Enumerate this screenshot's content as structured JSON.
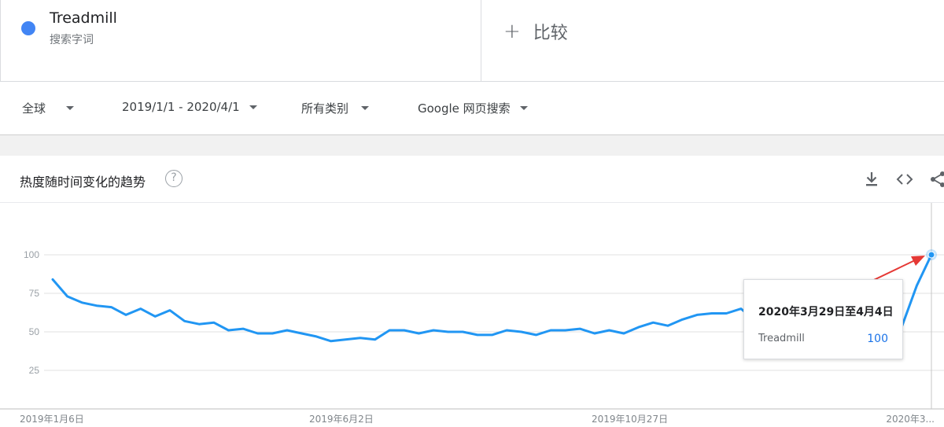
{
  "term": {
    "name": "Treadmill",
    "subtitle": "搜索字词",
    "dot_color": "#4285f4"
  },
  "compare": {
    "plus": "+",
    "label": "比较"
  },
  "filters": {
    "region": "全球",
    "date_range": "2019/1/1 - 2020/4/1",
    "category": "所有类别",
    "search_type": "Google 网页搜索"
  },
  "card": {
    "title": "热度随时间变化的趋势",
    "help_glyph": "?",
    "icons": [
      "download-icon",
      "embed-code-icon",
      "share-icon"
    ]
  },
  "tooltip": {
    "date": "2020年3月29日至4月4日",
    "term": "Treadmill",
    "value": "100"
  },
  "chart_data": {
    "type": "line",
    "ylim": [
      0,
      100
    ],
    "yticks": [
      25,
      50,
      75,
      100
    ],
    "x_tick_labels": [
      "2019年1月6日",
      "2019年6月2日",
      "2019年10月27日",
      "2020年3..."
    ],
    "series": [
      {
        "name": "Treadmill",
        "color": "#2196f3",
        "values": [
          84,
          73,
          69,
          67,
          66,
          61,
          65,
          60,
          64,
          57,
          55,
          56,
          51,
          52,
          49,
          49,
          51,
          49,
          47,
          44,
          45,
          46,
          45,
          51,
          51,
          49,
          51,
          50,
          50,
          48,
          48,
          51,
          50,
          48,
          51,
          51,
          52,
          49,
          51,
          49,
          53,
          56,
          54,
          58,
          61,
          62,
          62,
          65,
          57,
          56,
          66,
          80,
          76,
          73,
          72,
          70,
          66,
          58,
          54,
          80,
          100
        ]
      }
    ],
    "annotation": "red-arrow-pointing-to-last-point"
  }
}
